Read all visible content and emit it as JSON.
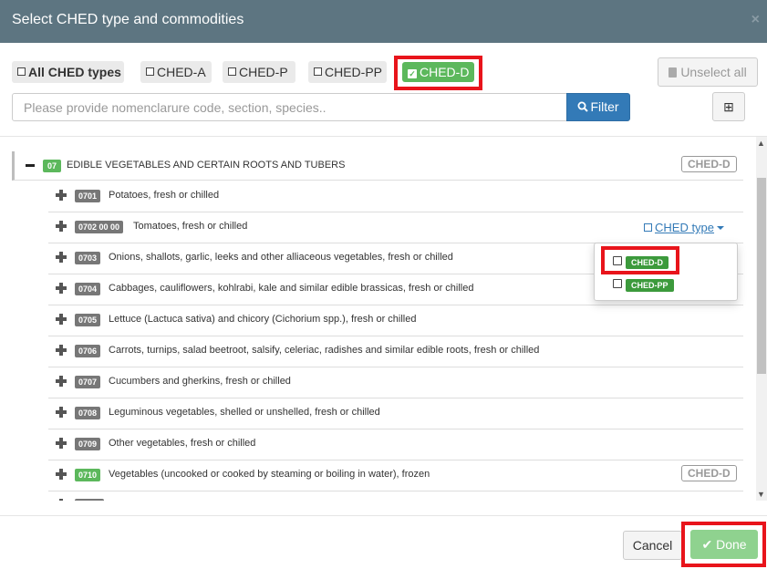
{
  "dialog": {
    "title": "Select CHED type and commodities",
    "close_glyph": "×"
  },
  "ched_types": {
    "all_label": "All CHED types",
    "ched_a_label": "CHED-A",
    "ched_p_label": "CHED-P",
    "ched_pp_label": "CHED-PP",
    "ched_d_label": "CHED-D",
    "ched_d_checked": true,
    "unselect_all_label": "Unselect all"
  },
  "search": {
    "placeholder": "Please provide nomenclarure code, section, species..",
    "value": "",
    "filter_label": "Filter",
    "grid_icon_glyph": "⊞"
  },
  "tree": {
    "parent": {
      "code": "07",
      "label": "EDIBLE VEGETABLES AND CERTAIN ROOTS AND TUBERS",
      "tag": "CHED-D"
    },
    "rows": [
      {
        "code": "0701",
        "label": "Potatoes, fresh or chilled",
        "code_color": "gray",
        "tag": ""
      },
      {
        "code": "0702 00 00",
        "label": "Tomatoes, fresh or chilled",
        "code_color": "gray",
        "tag": ""
      },
      {
        "code": "0703",
        "label": "Onions, shallots, garlic, leeks and other alliaceous vegetables, fresh or chilled",
        "code_color": "gray",
        "tag": ""
      },
      {
        "code": "0704",
        "label": "Cabbages, cauliflowers, kohlrabi, kale and similar edible brassicas, fresh or chilled",
        "code_color": "gray",
        "tag": ""
      },
      {
        "code": "0705",
        "label": "Lettuce (Lactuca sativa) and chicory (Cichorium spp.), fresh or chilled",
        "code_color": "gray",
        "tag": ""
      },
      {
        "code": "0706",
        "label": "Carrots, turnips, salad beetroot, salsify, celeriac, radishes and similar edible roots, fresh or chilled",
        "code_color": "gray",
        "tag": ""
      },
      {
        "code": "0707",
        "label": "Cucumbers and gherkins, fresh or chilled",
        "code_color": "gray",
        "tag": ""
      },
      {
        "code": "0708",
        "label": "Leguminous vegetables, shelled or unshelled, fresh or chilled",
        "code_color": "gray",
        "tag": ""
      },
      {
        "code": "0709",
        "label": "Other vegetables, fresh or chilled",
        "code_color": "gray",
        "tag": ""
      },
      {
        "code": "0710",
        "label": "Vegetables (uncooked or cooked by steaming or boiling in water), frozen",
        "code_color": "green",
        "tag": "CHED-D"
      }
    ],
    "ched_type_dropdown": {
      "link_label": "CHED type",
      "options": [
        {
          "label": "CHED-D",
          "checked": false
        },
        {
          "label": "CHED-PP",
          "checked": false
        }
      ]
    }
  },
  "footer": {
    "cancel_label": "Cancel",
    "done_label": "Done"
  },
  "colors": {
    "header_bg": "#5d7581",
    "primary": "#337ab7",
    "success": "#5cb85c",
    "highlight": "#e8141b"
  }
}
